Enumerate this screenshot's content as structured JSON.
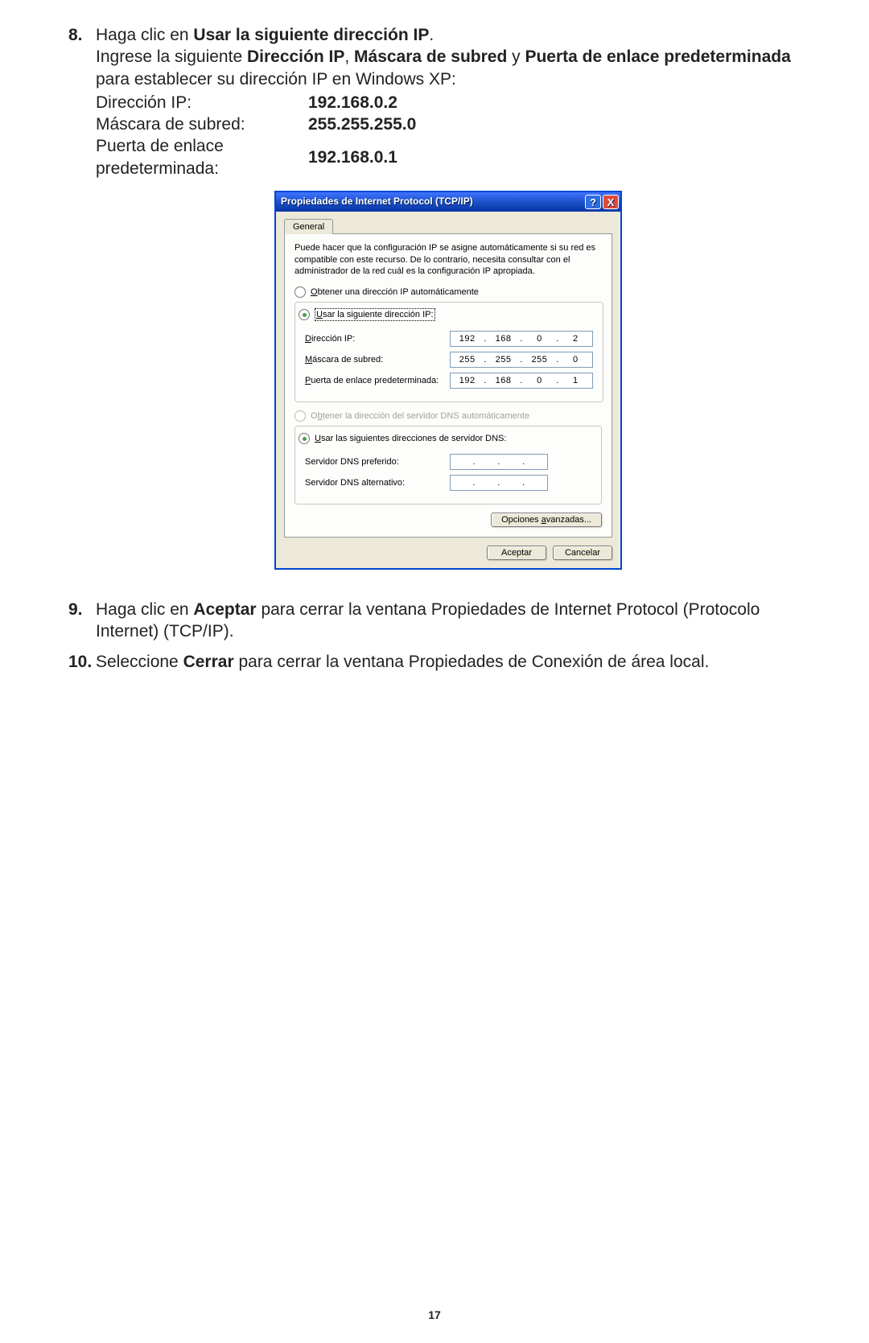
{
  "step8": {
    "num": "8.",
    "lead_plain": "Haga clic en ",
    "lead_bold": "Usar la siguiente dirección IP",
    "lead_end": ".",
    "para_a": "Ingrese la siguiente ",
    "para_b1": "Dirección IP",
    "para_comma": ", ",
    "para_b2": "Máscara de subred",
    "para_y": " y ",
    "para_b3": "Puerta de enlace predeterminada",
    "para_tail": " para establecer su dirección IP en Windows XP:",
    "rows": [
      {
        "label": "Dirección IP:",
        "value": "192.168.0.2"
      },
      {
        "label": "Máscara de subred:",
        "value": "255.255.255.0"
      },
      {
        "label": "Puerta de enlace predeterminada:",
        "value": "192.168.0.1"
      }
    ]
  },
  "dialog": {
    "title": "Propiedades de Internet Protocol (TCP/IP)",
    "tab": "General",
    "desc": "Puede hacer que la configuración IP se asigne automáticamente si su red es compatible con este recurso. De lo contrario, necesita consultar con el administrador de la red cuál es la configuración IP apropiada.",
    "opt_auto_ip_m": "O",
    "opt_auto_ip_rest": "btener una dirección IP automáticamente",
    "opt_use_ip_m": "U",
    "opt_use_ip_rest": "sar la siguiente dirección IP:",
    "ip_rows": [
      {
        "label_m": "D",
        "label_rest": "irección IP:",
        "ip": [
          "192",
          "168",
          "0",
          "2"
        ]
      },
      {
        "label_m": "M",
        "label_rest": "áscara de subred:",
        "ip": [
          "255",
          "255",
          "255",
          "0"
        ]
      },
      {
        "label_m": "P",
        "label_rest": "uerta de enlace predeterminada:",
        "ip": [
          "192",
          "168",
          "0",
          "1"
        ]
      }
    ],
    "opt_auto_dns_pre": "O",
    "opt_auto_dns_m": "b",
    "opt_auto_dns_rest": "tener la dirección del servidor DNS automáticamente",
    "opt_use_dns_m": "U",
    "opt_use_dns_rest": "sar las siguientes direcciones de servidor DNS:",
    "dns_rows": [
      {
        "label": "Servidor DNS preferido:"
      },
      {
        "label": "Servidor DNS alternativo:"
      }
    ],
    "adv": "Opciones ",
    "adv_m": "a",
    "adv_rest": "vanzadas...",
    "ok": "Aceptar",
    "cancel": "Cancelar"
  },
  "step9": {
    "num": "9.",
    "a": "Haga clic en ",
    "b": "Aceptar",
    "c": " para cerrar la ventana Propiedades de Internet Protocol (Protocolo Internet) (TCP/IP)."
  },
  "step10": {
    "num": "10.",
    "a": "Seleccione ",
    "b": "Cerrar",
    "c": " para cerrar la ventana Propiedades de Conexión de área local."
  },
  "pagenum": "17"
}
